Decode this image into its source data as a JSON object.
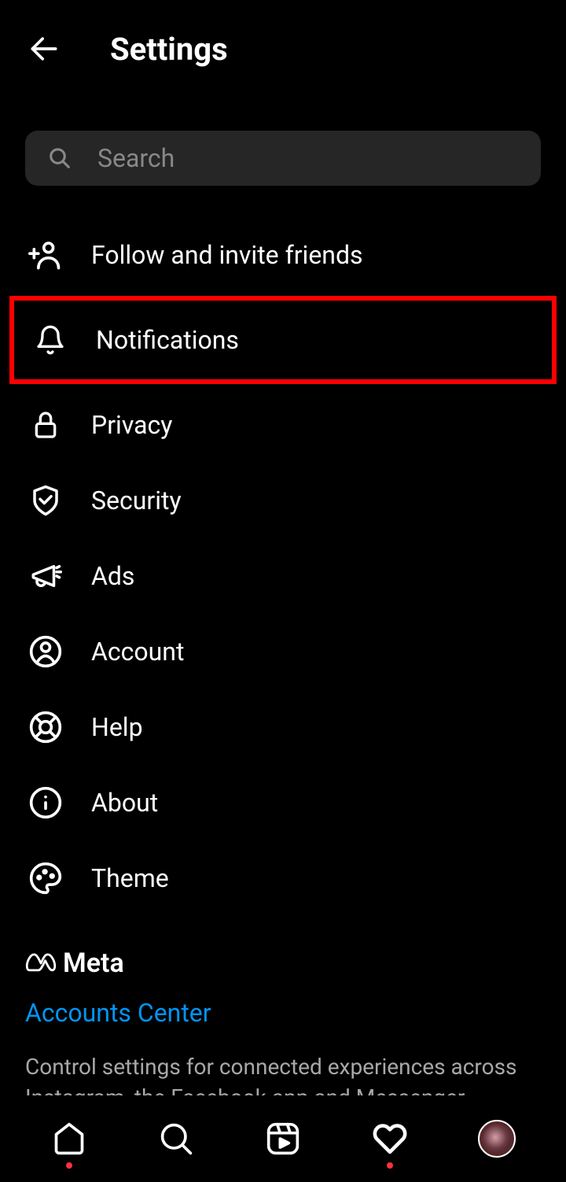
{
  "header": {
    "title": "Settings"
  },
  "search": {
    "placeholder": "Search"
  },
  "settings": {
    "items": [
      {
        "label": "Follow and invite friends",
        "icon": "person-add"
      },
      {
        "label": "Notifications",
        "icon": "bell",
        "highlighted": true
      },
      {
        "label": "Privacy",
        "icon": "lock"
      },
      {
        "label": "Security",
        "icon": "shield-check"
      },
      {
        "label": "Ads",
        "icon": "megaphone"
      },
      {
        "label": "Account",
        "icon": "user-circle"
      },
      {
        "label": "Help",
        "icon": "lifebuoy"
      },
      {
        "label": "About",
        "icon": "info"
      },
      {
        "label": "Theme",
        "icon": "palette"
      }
    ]
  },
  "meta": {
    "brand": "Meta",
    "accounts_center": "Accounts Center",
    "description": "Control settings for connected experiences across Instagram, the Facebook app and Messenger,"
  }
}
